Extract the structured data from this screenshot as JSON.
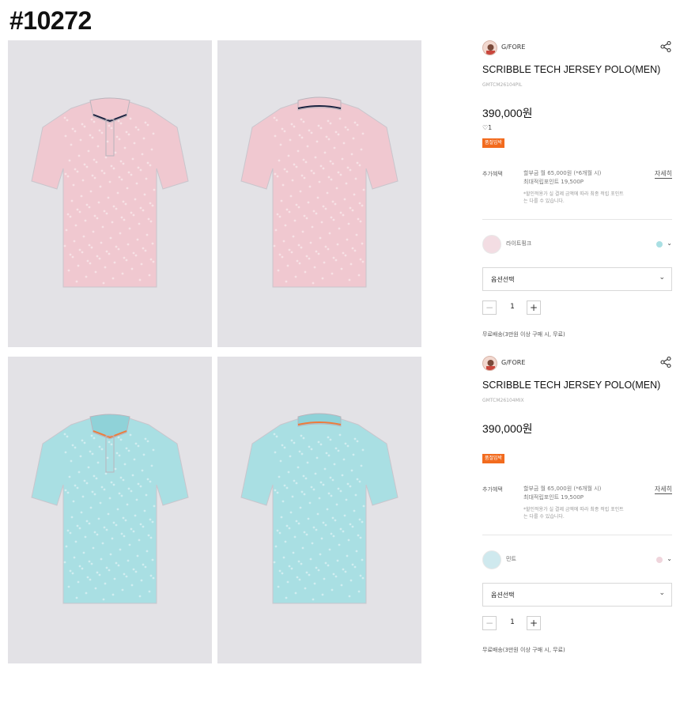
{
  "header": {
    "id_label": "#10272"
  },
  "gallery": [
    {
      "name": "pink-front",
      "color": "#f0c8d0",
      "collar": "#f0c8d0",
      "tip": "#1a2340",
      "view": "front"
    },
    {
      "name": "pink-back",
      "color": "#f0c8d0",
      "collar": "#f0c8d0",
      "tip": "#1a2340",
      "view": "back"
    },
    {
      "name": "mint-front",
      "color": "#a9dfe3",
      "collar": "#8fd2d8",
      "tip": "#f07a3a",
      "view": "front"
    },
    {
      "name": "mint-back",
      "color": "#a9dfe3",
      "collar": "#8fd2d8",
      "tip": "#f07a3a",
      "view": "back"
    }
  ],
  "products": [
    {
      "brand": "G/FORE",
      "title": "SCRIBBLE TECH JERSEY POLO(MEN)",
      "code": "GMTCM26104PIL",
      "price": "390,000원",
      "likes": "1",
      "show_likes": true,
      "badge": "품절임박",
      "benefit_label": "추가혜택",
      "benefit_line1": "할부금 월 65,000원 (*6개월 시)",
      "benefit_line2": "최대적립포인트 19,500P",
      "benefit_note": "*할인적용가 실 결제 금액에 따라 최종 적립 포인트는 다를 수 있습니다.",
      "detail_link": "자세히",
      "color_name": "라이트핑크",
      "swatch_color": "#f3dde3",
      "alt_color_dot": "#a9dfe3",
      "option_label": "옵션선택",
      "quantity": "1",
      "shipping": "무료배송(3만원 이상 구매 시, 무료)"
    },
    {
      "brand": "G/FORE",
      "title": "SCRIBBLE TECH JERSEY POLO(MEN)",
      "code": "GMTCM26104MIX",
      "price": "390,000원",
      "likes": "",
      "show_likes": false,
      "badge": "품절임박",
      "benefit_label": "추가혜택",
      "benefit_line1": "할부금 월 65,000원 (*6개월 시)",
      "benefit_line2": "최대적립포인트 19,500P",
      "benefit_note": "*할인적용가 실 결제 금액에 따라 최종 적립 포인트는 다를 수 있습니다.",
      "detail_link": "자세히",
      "color_name": "민트",
      "swatch_color": "#cfe9ee",
      "alt_color_dot": "#efd5dc",
      "option_label": "옵션선택",
      "quantity": "1",
      "shipping": "무료배송(3만원 이상 구매 시, 무료)"
    }
  ],
  "colors": {
    "accent_badge": "#f26b1e",
    "photo_bg": "#e3e2e6"
  },
  "icons": {
    "share": "share-icon",
    "heart": "heart-icon",
    "chevron": "chevron-down-icon"
  }
}
